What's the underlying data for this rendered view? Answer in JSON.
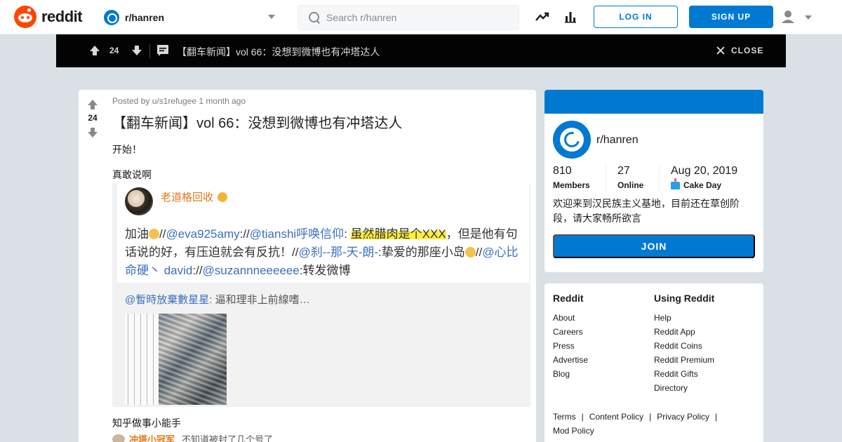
{
  "header": {
    "logo_text": "reddit",
    "subreddit": "r/hanren",
    "search_placeholder": "Search r/hanren",
    "login_label": "LOG IN",
    "signup_label": "SIGN UP"
  },
  "postbar": {
    "score": "24",
    "title": "【翻车新闻】vol 66：没想到微博也有冲塔达人",
    "close_label": "CLOSE"
  },
  "post": {
    "score": "24",
    "meta": "Posted by u/s1refugee 1 month ago",
    "title": "【翻车新闻】vol 66：没想到微博也有冲塔达人",
    "para1": "开始！",
    "para2": "真敢说啊",
    "para3": "知乎做事小能手",
    "embed": {
      "username": "老道格回收",
      "l1_a": "加油",
      "l1_b": "//",
      "l1_at1": "@eva925amy",
      "l1_c": "://",
      "l1_at2": "@tianshi呼唤信仰",
      "l1_d": ": ",
      "l1_hl": "虽然腊肉是个XXX",
      "l1_e": "，但是他有句",
      "l2_a": "话说的好，有压迫就会有反抗！//",
      "l2_at1": "@刹--那-天-朗-",
      "l2_b": ":挚爱的那座小岛",
      "l2_c": "//",
      "l2_at2": "@心比",
      "l3_at1": "命硬丶 david",
      "l3_a": "://",
      "l3_at2": "@suzannneeeeee",
      "l3_b": ":转发微博",
      "reply_at": "@暫時放棄數星星",
      "reply_text": ": 逼和理非上前線嗜…",
      "cut_user": "冲塔小冠军",
      "cut_text": "不知道被封了几个号了"
    }
  },
  "sidebar": {
    "name": "r/hanren",
    "members_value": "810",
    "members_label": "Members",
    "online_value": "27",
    "online_label": "Online",
    "cake_value": "Aug 20, 2019",
    "cake_label": "Cake Day",
    "description": "欢迎来到汉民族主义基地，目前还在草创阶段，请大家畅所欲言",
    "join_label": "JOIN"
  },
  "footer": {
    "col1_title": "Reddit",
    "col1": [
      "About",
      "Careers",
      "Press",
      "Advertise",
      "Blog"
    ],
    "col2_title": "Using Reddit",
    "col2": [
      "Help",
      "Reddit App",
      "Reddit Coins",
      "Reddit Premium",
      "Reddit Gifts",
      "Directory"
    ],
    "legal": [
      "Terms",
      "Content Policy",
      "Privacy Policy",
      "Mod Policy"
    ]
  },
  "colors": {
    "brand": "#ff4500",
    "accent": "#0079d3",
    "postbar_bg": "#030303",
    "page_bg": "#dae0e6"
  }
}
